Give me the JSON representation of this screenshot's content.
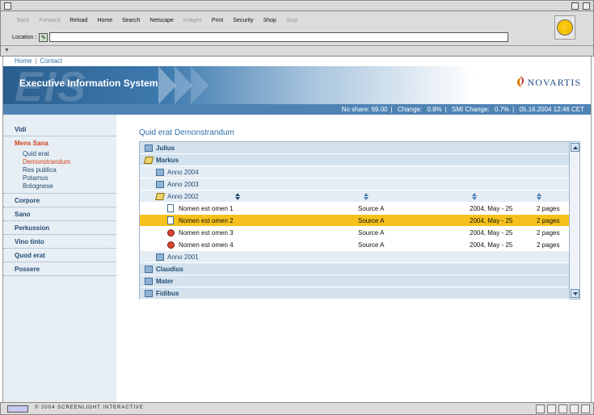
{
  "browser": {
    "toolbar": [
      {
        "label": "Back",
        "enabled": false
      },
      {
        "label": "Forward",
        "enabled": false
      },
      {
        "label": "Reload",
        "enabled": true
      },
      {
        "label": "Home",
        "enabled": true
      },
      {
        "label": "Search",
        "enabled": true
      },
      {
        "label": "Netscape",
        "enabled": true
      },
      {
        "label": "Images",
        "enabled": false
      },
      {
        "label": "Print",
        "enabled": true
      },
      {
        "label": "Security",
        "enabled": true
      },
      {
        "label": "Shop",
        "enabled": true
      },
      {
        "label": "Stop",
        "enabled": false
      }
    ],
    "location_label": "Location :",
    "location_value": ""
  },
  "topnav": {
    "home": "Home",
    "separator": "|",
    "contact": "Contact"
  },
  "banner": {
    "watermark": "EIS",
    "title": "Executive Information System",
    "logo_text": "NOVARTIS"
  },
  "infobar": {
    "share_label": "No share:",
    "share_value": "69.00",
    "change_label": "Change:",
    "change_value": "0.8%",
    "smi_label": "SMI Change:",
    "smi_value": "0.7%",
    "date": "05.16.2004",
    "time": "12:46 CET",
    "up_arrow": "↑"
  },
  "sidebar": {
    "items": [
      {
        "label": "Vidi",
        "active": false
      },
      {
        "label": "Mens Sana",
        "active": true,
        "subitems": [
          {
            "label": "Quid erat",
            "active": false
          },
          {
            "label": "Demonstrandum",
            "active": true
          },
          {
            "label": "Res publica",
            "active": false
          },
          {
            "label": "Potamus",
            "active": false
          },
          {
            "label": "Bolognese",
            "active": false
          }
        ]
      },
      {
        "label": "Corpore",
        "active": false
      },
      {
        "label": "Sano",
        "active": false
      },
      {
        "label": "Perkussion",
        "active": false
      },
      {
        "label": "Vino tinto",
        "active": false
      },
      {
        "label": "Quod erat",
        "active": false
      },
      {
        "label": "Possere",
        "active": false
      }
    ]
  },
  "main": {
    "title": "Quid erat Demonstrandum",
    "tree": [
      {
        "level": 0,
        "label": "Julius",
        "icon": "folder-icon"
      },
      {
        "level": 0,
        "label": "Markus",
        "icon": "folder-open-icon"
      },
      {
        "level": 1,
        "label": "Anno 2004",
        "icon": "folder-icon"
      },
      {
        "level": 1,
        "label": "Anno 2003",
        "icon": "folder-icon"
      },
      {
        "level": 1,
        "label": "Anno 2002",
        "icon": "folder-open-icon",
        "header": true
      },
      {
        "level": 2,
        "label": "Nomen est omen 1",
        "icon": "document-icon",
        "source": "Source A",
        "date": "2004, May - 25",
        "pages": "2 pages"
      },
      {
        "level": 2,
        "label": "Nomen est omen 2",
        "icon": "document-icon",
        "source": "Source A",
        "date": "2004, May - 25",
        "pages": "2 pages",
        "selected": true
      },
      {
        "level": 2,
        "label": "Nomen est omen 3",
        "icon": "document-alert-icon",
        "source": "Source A",
        "date": "2004, May - 25",
        "pages": "2 pages"
      },
      {
        "level": 2,
        "label": "Nomen est omen 4",
        "icon": "document-alert-icon",
        "source": "Source A",
        "date": "2004, May - 25",
        "pages": "2 pages"
      },
      {
        "level": 1,
        "label": "Anno 2001",
        "icon": "folder-icon"
      },
      {
        "level": 0,
        "label": "Claudius",
        "icon": "folder-icon"
      },
      {
        "level": 0,
        "label": "Mater",
        "icon": "folder-icon"
      },
      {
        "level": 0,
        "label": "Fidibus",
        "icon": "folder-icon"
      }
    ]
  },
  "statusbar": {
    "text": "© 2004 SCREENLIGHT INTERACTIVE"
  },
  "colors": {
    "accent": "#4f83b4",
    "selected_row": "#f6c11c",
    "active_nav": "#d2421a",
    "up": "#2aa836"
  }
}
